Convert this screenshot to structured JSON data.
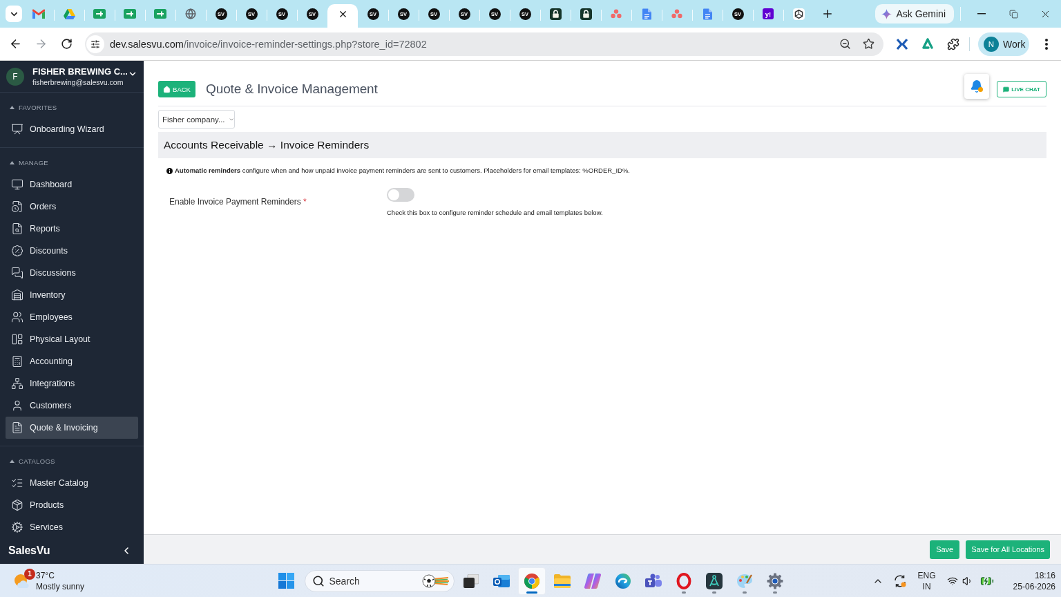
{
  "browser": {
    "tabs": [
      {
        "kind": "mail",
        "selected": false
      },
      {
        "kind": "drive",
        "selected": false
      },
      {
        "kind": "sheet",
        "selected": false
      },
      {
        "kind": "sheet",
        "selected": false
      },
      {
        "kind": "sheet",
        "selected": false
      },
      {
        "kind": "globe",
        "selected": false
      },
      {
        "kind": "sv",
        "text": "SV",
        "selected": false
      },
      {
        "kind": "sv",
        "text": "SV",
        "selected": false
      },
      {
        "kind": "sv",
        "text": "SV",
        "selected": false
      },
      {
        "kind": "sv",
        "text": "SV",
        "selected": false
      },
      {
        "kind": "blank",
        "selected": true
      },
      {
        "kind": "sv",
        "text": "SV",
        "selected": false
      },
      {
        "kind": "sv",
        "text": "SV",
        "selected": false
      },
      {
        "kind": "sv",
        "text": "SV",
        "selected": false
      },
      {
        "kind": "sv",
        "text": "SV",
        "selected": false
      },
      {
        "kind": "sv",
        "text": "SV",
        "selected": false
      },
      {
        "kind": "sv",
        "text": "SV",
        "selected": false
      },
      {
        "kind": "lock",
        "selected": false
      },
      {
        "kind": "lock",
        "selected": false
      },
      {
        "kind": "dots",
        "selected": false
      },
      {
        "kind": "doc",
        "selected": false
      },
      {
        "kind": "dots",
        "selected": false
      },
      {
        "kind": "doc",
        "selected": false
      },
      {
        "kind": "sv",
        "text": "SV",
        "selected": false
      },
      {
        "kind": "yahoo",
        "text": "y!",
        "selected": false
      },
      {
        "kind": "knot",
        "selected": false
      }
    ],
    "gemini": "Ask Gemini",
    "url": {
      "host": "dev.salesvu.com",
      "path": "/invoice/invoice-reminder-settings.php?store_id=72802"
    },
    "profile": {
      "initial": "N",
      "label": "Work"
    }
  },
  "sidebar": {
    "account": {
      "initial": "F",
      "name": "FISHER BREWING C...",
      "email": "fisherbrewing@salesvu.com"
    },
    "sections": [
      {
        "title": "FAVORITES",
        "expanded": true,
        "items": [
          {
            "label": "Onboarding Wizard",
            "kind": "wizard",
            "selected": false
          }
        ]
      },
      {
        "title": "MANAGE",
        "expanded": true,
        "items": [
          {
            "label": "Dashboard",
            "kind": "dashboard",
            "selected": false
          },
          {
            "label": "Orders",
            "kind": "orders",
            "selected": false
          },
          {
            "label": "Reports",
            "kind": "reports",
            "selected": false
          },
          {
            "label": "Discounts",
            "kind": "discounts",
            "selected": false
          },
          {
            "label": "Discussions",
            "kind": "discussions",
            "selected": false
          },
          {
            "label": "Inventory",
            "kind": "inventory",
            "selected": false
          },
          {
            "label": "Employees",
            "kind": "employees",
            "selected": false
          },
          {
            "label": "Physical Layout",
            "kind": "layout",
            "selected": false
          },
          {
            "label": "Accounting",
            "kind": "accounting",
            "selected": false
          },
          {
            "label": "Integrations",
            "kind": "integrations",
            "selected": false
          },
          {
            "label": "Customers",
            "kind": "customers",
            "selected": false
          },
          {
            "label": "Quote & Invoicing",
            "kind": "invoicing",
            "selected": true
          }
        ]
      },
      {
        "title": "CATALOGS",
        "expanded": true,
        "items": [
          {
            "label": "Master Catalog",
            "kind": "catalog",
            "selected": false
          },
          {
            "label": "Products",
            "kind": "products",
            "selected": false
          },
          {
            "label": "Services",
            "kind": "services",
            "selected": false
          }
        ]
      }
    ],
    "brand": "SalesVu"
  },
  "page": {
    "back": "BACK",
    "title": "Quote & Invoice Management",
    "alert": true,
    "live_chat": "LIVE CHAT",
    "location": "Fisher company...",
    "section_title": "Accounts Receivable → Invoice Reminders",
    "info": "**Automatic reminders** configure when and how unpaid invoice payment reminders are sent to customers. Placeholders for email templates: %ORDER_ID%.",
    "fields": [
      {
        "kind": "toggle",
        "label": "Enable Invoice Payment Reminders",
        "required_mark": "*",
        "on": false,
        "help": "Check this box to configure reminder schedule and email templates below."
      }
    ]
  },
  "footer": {
    "actions": [
      "Save",
      "Save for All Locations"
    ]
  },
  "taskbar": {
    "weather": {
      "badge": "1",
      "temperature": "37°C",
      "condition": "Mostly sunny"
    },
    "search": {
      "placeholder": "Search"
    },
    "apps": [
      {
        "kind": "taskview",
        "running": false,
        "selected": false
      },
      {
        "kind": "mail",
        "running": false,
        "selected": false
      },
      {
        "kind": "chrome",
        "running": true,
        "selected": true
      },
      {
        "kind": "folder",
        "running": false,
        "selected": false
      },
      {
        "kind": "copilot",
        "running": false,
        "selected": false
      },
      {
        "kind": "edge",
        "running": false,
        "selected": false
      },
      {
        "kind": "teams",
        "running": false,
        "selected": false
      },
      {
        "kind": "opera",
        "running": true,
        "selected": false
      },
      {
        "kind": "compass",
        "running": true,
        "selected": false
      },
      {
        "kind": "paint",
        "running": true,
        "selected": false
      },
      {
        "kind": "settings",
        "running": true,
        "selected": false
      }
    ],
    "tray": {
      "language": "ENG",
      "region": "IN",
      "time": "18:16",
      "date": "25-06-2026"
    }
  }
}
